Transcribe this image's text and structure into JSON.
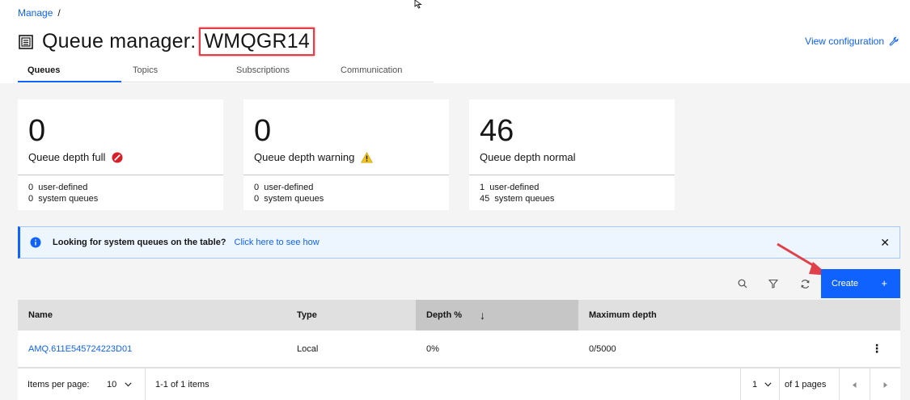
{
  "breadcrumb": {
    "item": "Manage",
    "separator": "/"
  },
  "header": {
    "title_prefix": "Queue manager:",
    "queue_manager_name": "WMQGR14",
    "view_configuration": "View configuration"
  },
  "tabs": [
    {
      "label": "Queues",
      "selected": true
    },
    {
      "label": "Topics"
    },
    {
      "label": "Subscriptions"
    },
    {
      "label": "Communication"
    }
  ],
  "cards": [
    {
      "count": "0",
      "label": "Queue depth full",
      "status_icon": "error-icon",
      "user_defined": "0",
      "user_defined_label": "user-defined",
      "system": "0",
      "system_label": "system queues"
    },
    {
      "count": "0",
      "label": "Queue depth warning",
      "status_icon": "warning-icon",
      "user_defined": "0",
      "user_defined_label": "user-defined",
      "system": "0",
      "system_label": "system queues"
    },
    {
      "count": "46",
      "label": "Queue depth normal",
      "user_defined": "1",
      "user_defined_label": "user-defined",
      "system": "45",
      "system_label": "system queues"
    }
  ],
  "notification": {
    "text": "Looking for system queues on the table?",
    "link": "Click here to see how",
    "close_symbol": "✕"
  },
  "toolbar": {
    "icons": [
      "search-icon",
      "filter-icon",
      "refresh-icon"
    ],
    "create_label": "Create",
    "create_symbol": "+"
  },
  "table": {
    "columns": [
      "Name",
      "Type",
      "Depth %",
      "Maximum depth"
    ],
    "sort_symbol": "↓",
    "rows": [
      {
        "name": "AMQ.611E545724223D01",
        "type": "Local",
        "depth": "0%",
        "max_depth": "0/5000",
        "menu": "⋮"
      }
    ]
  },
  "pagination": {
    "items_per_page_label": "Items per page:",
    "items_per_page": "10",
    "range": "1-1 of 1 items",
    "page": "1",
    "of_pages": "of 1 pages"
  },
  "colors": {
    "accent": "#0f62fe",
    "error": "#da1e28",
    "warning": "#f1c21b",
    "annotation": "#e0404a"
  }
}
